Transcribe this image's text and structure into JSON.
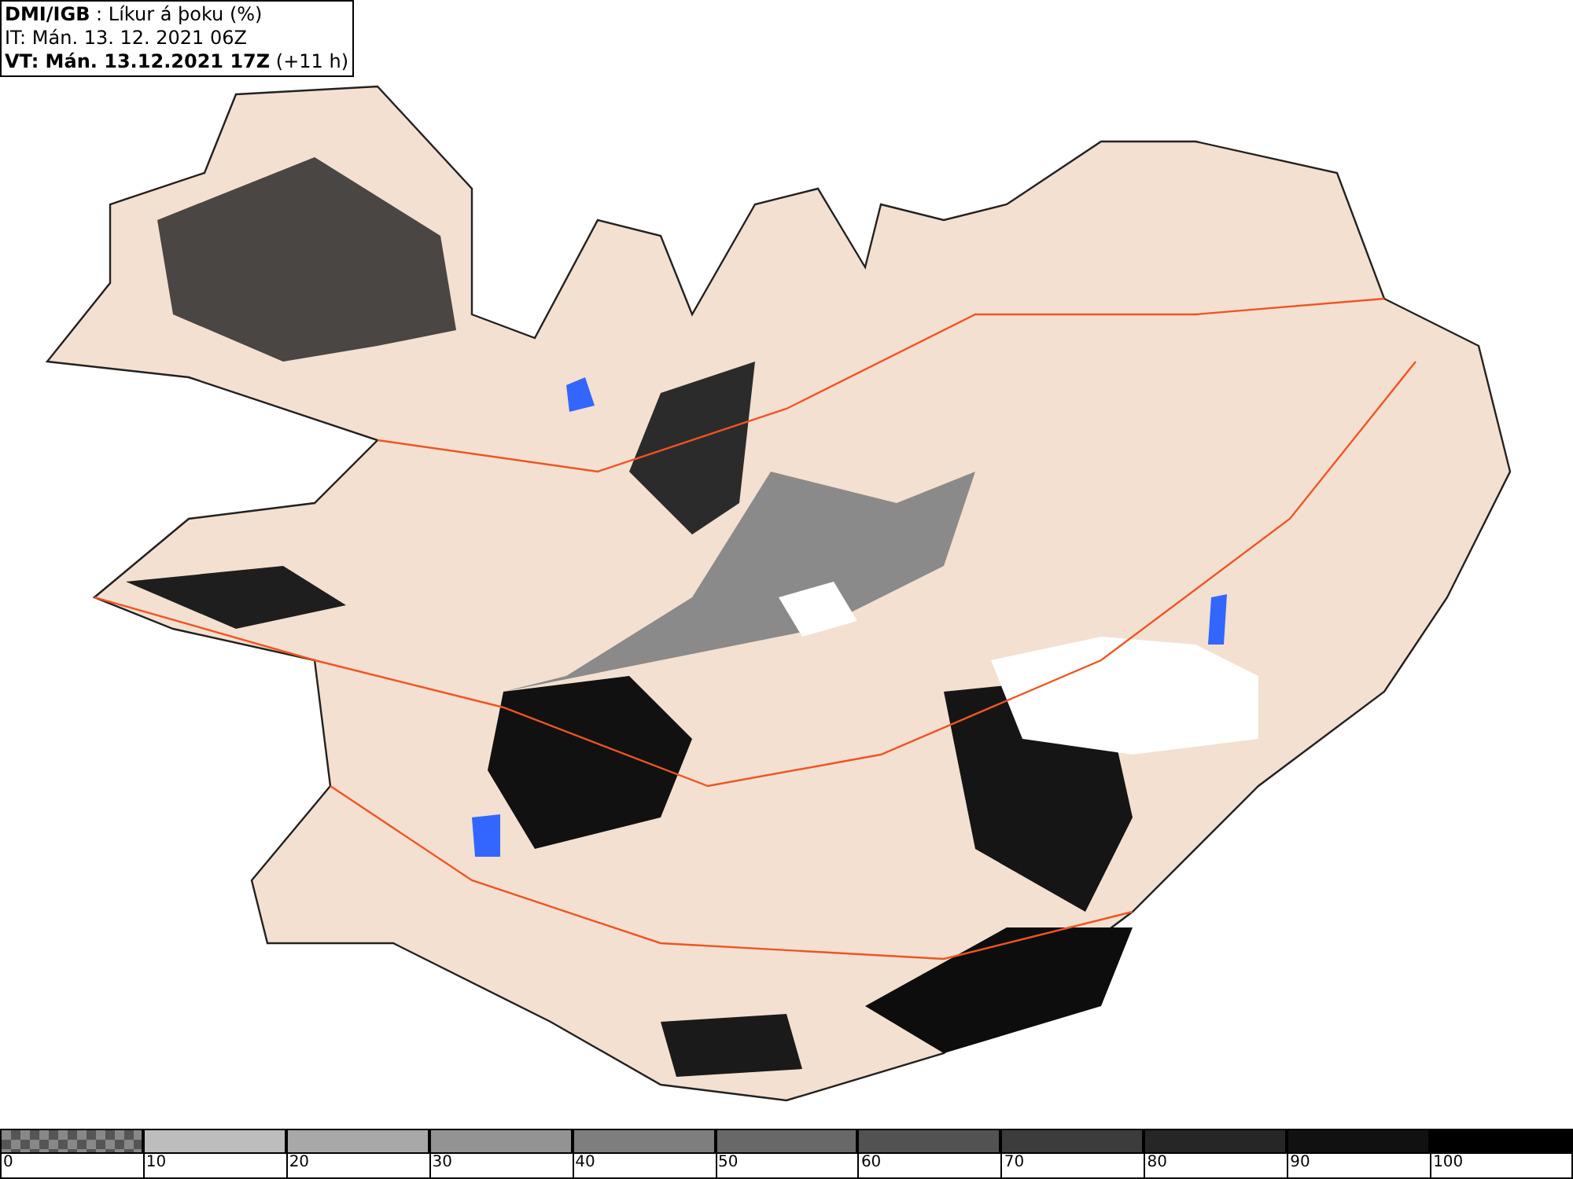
{
  "header": {
    "lines": [
      "**DMI/IGB** : Líkur á þoku (%)",
      "IT: Mán. 13. 12. 2021 06Z",
      "**VT: Mán. 13.12.2021 17Z** (+11 h)"
    ]
  },
  "legend": {
    "bins": [
      {
        "kind": "checker",
        "label": "0",
        "color": "#888888"
      },
      {
        "kind": "solid",
        "label": "10",
        "color": "#bdbdbd"
      },
      {
        "kind": "solid",
        "label": "20",
        "color": "#a8a8a8"
      },
      {
        "kind": "solid",
        "label": "30",
        "color": "#939393"
      },
      {
        "kind": "solid",
        "label": "40",
        "color": "#7e7e7e"
      },
      {
        "kind": "solid",
        "label": "50",
        "color": "#686868"
      },
      {
        "kind": "solid",
        "label": "60",
        "color": "#525252"
      },
      {
        "kind": "solid",
        "label": "70",
        "color": "#3c3c3c"
      },
      {
        "kind": "solid",
        "label": "80",
        "color": "#262626"
      },
      {
        "kind": "solid",
        "label": "90",
        "color": "#111111"
      },
      {
        "kind": "solid",
        "label": "100",
        "color": "#000000"
      }
    ]
  }
}
